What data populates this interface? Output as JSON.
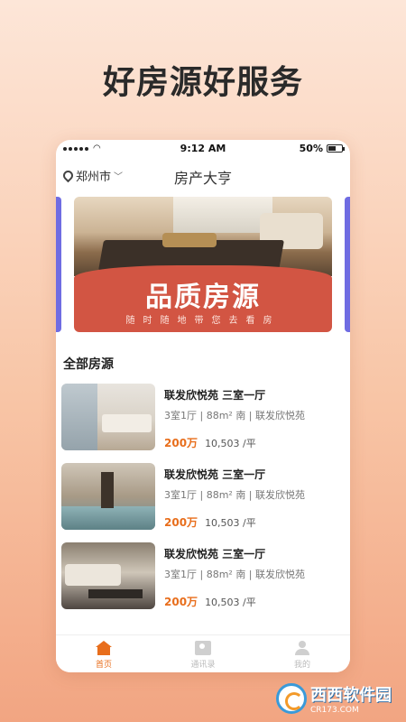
{
  "headline": "好房源好服务",
  "status_bar": {
    "time": "9:12 AM",
    "battery": "50%"
  },
  "header": {
    "city": "郑州市",
    "title": "房产大亨"
  },
  "banner": {
    "title": "品质房源",
    "subtitle": "随时随地带您去看房"
  },
  "section_title": "全部房源",
  "listings": [
    {
      "name": "联发欣悦苑 三室一厅",
      "meta": "3室1厅 | 88m² 南 | 联发欣悦苑",
      "price": "200万",
      "unit_price": "10,503 /平"
    },
    {
      "name": "联发欣悦苑 三室一厅",
      "meta": "3室1厅 | 88m² 南 | 联发欣悦苑",
      "price": "200万",
      "unit_price": "10,503 /平"
    },
    {
      "name": "联发欣悦苑 三室一厅",
      "meta": "3室1厅 | 88m² 南 | 联发欣悦苑",
      "price": "200万",
      "unit_price": "10,503 /平"
    }
  ],
  "tabbar": {
    "home": "首页",
    "contacts": "通讯录",
    "mine": "我的"
  },
  "watermark": {
    "name": "西西软件园",
    "site": "CR173.COM"
  },
  "colors": {
    "accent": "#e86e1c",
    "banner_red": "#d25543",
    "side_purple": "#6f6ce2"
  }
}
